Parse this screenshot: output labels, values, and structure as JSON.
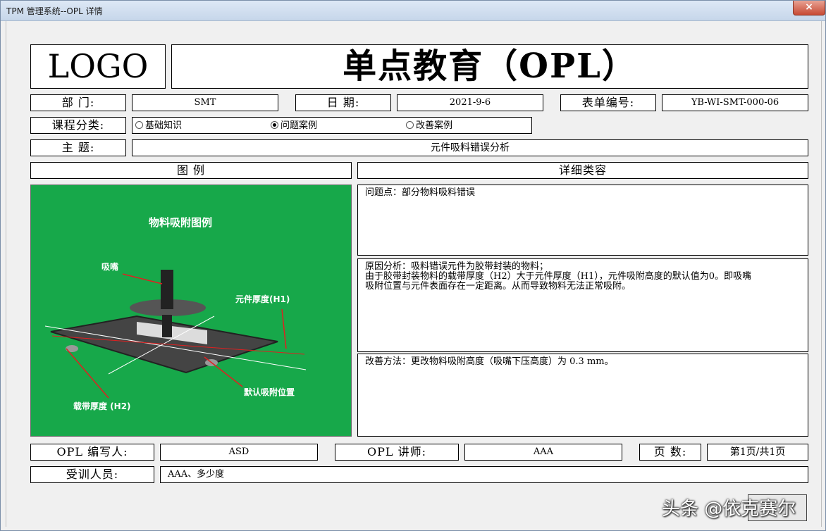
{
  "window": {
    "title": "TPM 管理系统--OPL 详情",
    "close_label": "×"
  },
  "header": {
    "logo": "LOGO",
    "title": "单点教育（OPL）"
  },
  "row1": {
    "dept_label": "部 门:",
    "dept_value": "SMT",
    "date_label": "日 期:",
    "date_value": "2021-9-6",
    "form_label": "表单编号:",
    "form_value": "YB-WI-SMT-000-06"
  },
  "category": {
    "label": "课程分类:",
    "options": [
      {
        "label": "基础知识",
        "selected": false
      },
      {
        "label": "问题案例",
        "selected": true
      },
      {
        "label": "改善案例",
        "selected": false
      }
    ]
  },
  "topic": {
    "label": "主 题:",
    "value": "元件吸料错误分析"
  },
  "sections": {
    "illustration": "图 例",
    "detail": "详细类容"
  },
  "figure": {
    "title": "物料吸附图例",
    "nozzle_label": "吸嘴",
    "thickness_label": "元件厚度(H1)",
    "tape_label": "载带厚度 (H2)",
    "default_pos_label": "默认吸附位置"
  },
  "details": {
    "problem": "问题点：部分物料吸料错误",
    "cause_line1": "原因分析：吸料错误元件为胶带封装的物料；",
    "cause_line2": "由于胶带封装物料的载带厚度（H2）大于元件厚度（H1），元件吸附高度的默认值为0。即吸嘴",
    "cause_line3": "吸附位置与元件表面存在一定距离。从而导致物料无法正常吸附。",
    "improve": "改善方法：更改物料吸附高度（吸嘴下压高度）为 0.3 mm。"
  },
  "footer": {
    "author_label": "OPL 编写人:",
    "author_value": "ASD",
    "teacher_label": "OPL 讲师:",
    "teacher_value": "AAA",
    "pages_label": "页 数:",
    "pages_value": "第1页/共1页",
    "trainee_label": "受训人员:",
    "trainee_value": "AAA、多少度"
  },
  "watermark": "头条 @依克赛尔"
}
